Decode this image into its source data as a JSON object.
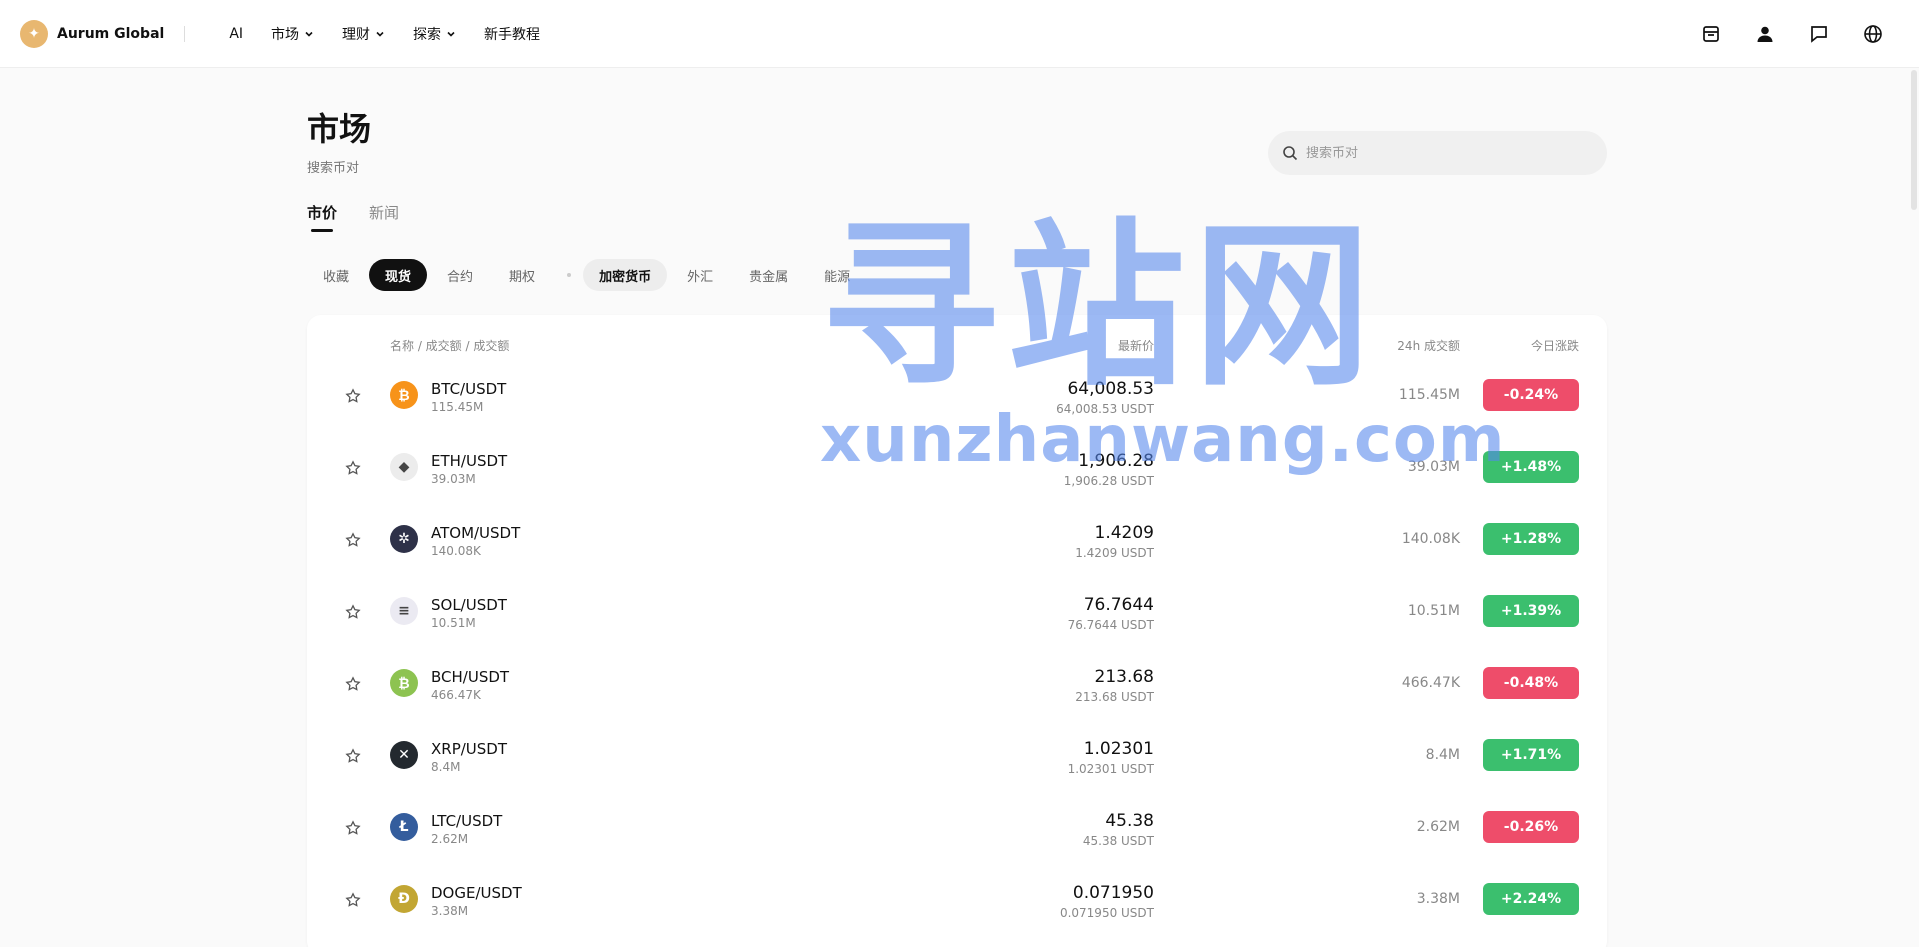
{
  "header": {
    "brand": "Aurum Global",
    "nav": [
      {
        "label": "AI",
        "has_dropdown": false
      },
      {
        "label": "市场",
        "has_dropdown": true
      },
      {
        "label": "理财",
        "has_dropdown": true
      },
      {
        "label": "探索",
        "has_dropdown": true
      },
      {
        "label": "新手教程",
        "has_dropdown": false
      }
    ],
    "actions": [
      "inbox-icon",
      "user-icon",
      "message-icon",
      "globe-icon"
    ]
  },
  "page": {
    "title": "市场",
    "subtitle": "搜索币对",
    "search_placeholder": "搜索币对"
  },
  "tabs": [
    {
      "label": "市价",
      "active": true
    },
    {
      "label": "新闻",
      "active": false
    }
  ],
  "chips": [
    {
      "label": "收藏",
      "state": "normal"
    },
    {
      "label": "现货",
      "state": "active-dark"
    },
    {
      "label": "合约",
      "state": "normal"
    },
    {
      "label": "期权",
      "state": "normal"
    },
    {
      "label": "加密货币",
      "state": "active-light"
    },
    {
      "label": "外汇",
      "state": "normal"
    },
    {
      "label": "贵金属",
      "state": "normal"
    },
    {
      "label": "能源",
      "state": "normal"
    }
  ],
  "table": {
    "headers": {
      "name": "名称 / 成交额 / 成交额",
      "price": "最新价",
      "volume": "24h 成交额",
      "change": "今日涨跌"
    },
    "rows": [
      {
        "pair": "BTC/USDT",
        "vol": "115.45M",
        "price": "64,008.53",
        "price_sub": "64,008.53 USDT",
        "vol24": "115.45M",
        "change": "-0.24%",
        "dir": "down",
        "coin": "btc",
        "color": "#f7931a",
        "glyph": "₿"
      },
      {
        "pair": "ETH/USDT",
        "vol": "39.03M",
        "price": "1,906.28",
        "price_sub": "1,906.28 USDT",
        "vol24": "39.03M",
        "change": "+1.48%",
        "dir": "up",
        "coin": "eth",
        "color": "#ececec",
        "glyph": "◆"
      },
      {
        "pair": "ATOM/USDT",
        "vol": "140.08K",
        "price": "1.4209",
        "price_sub": "1.4209 USDT",
        "vol24": "140.08K",
        "change": "+1.28%",
        "dir": "up",
        "coin": "atom",
        "color": "#2e3148",
        "glyph": "✲"
      },
      {
        "pair": "SOL/USDT",
        "vol": "10.51M",
        "price": "76.7644",
        "price_sub": "76.7644 USDT",
        "vol24": "10.51M",
        "change": "+1.39%",
        "dir": "up",
        "coin": "sol",
        "color": "#ebeaf2",
        "glyph": "≡"
      },
      {
        "pair": "BCH/USDT",
        "vol": "466.47K",
        "price": "213.68",
        "price_sub": "213.68 USDT",
        "vol24": "466.47K",
        "change": "-0.48%",
        "dir": "down",
        "coin": "bch",
        "color": "#8dc351",
        "glyph": "₿"
      },
      {
        "pair": "XRP/USDT",
        "vol": "8.4M",
        "price": "1.02301",
        "price_sub": "1.02301 USDT",
        "vol24": "8.4M",
        "change": "+1.71%",
        "dir": "up",
        "coin": "xrp",
        "color": "#23292f",
        "glyph": "✕"
      },
      {
        "pair": "LTC/USDT",
        "vol": "2.62M",
        "price": "45.38",
        "price_sub": "45.38 USDT",
        "vol24": "2.62M",
        "change": "-0.26%",
        "dir": "down",
        "coin": "ltc",
        "color": "#345d9d",
        "glyph": "Ł"
      },
      {
        "pair": "DOGE/USDT",
        "vol": "3.38M",
        "price": "0.071950",
        "price_sub": "0.071950 USDT",
        "vol24": "3.38M",
        "change": "+2.24%",
        "dir": "up",
        "coin": "doge",
        "color": "#c2a633",
        "glyph": "Ð"
      }
    ]
  },
  "watermark": {
    "cn": "寻站网",
    "en": "xunzhanwang.com"
  }
}
